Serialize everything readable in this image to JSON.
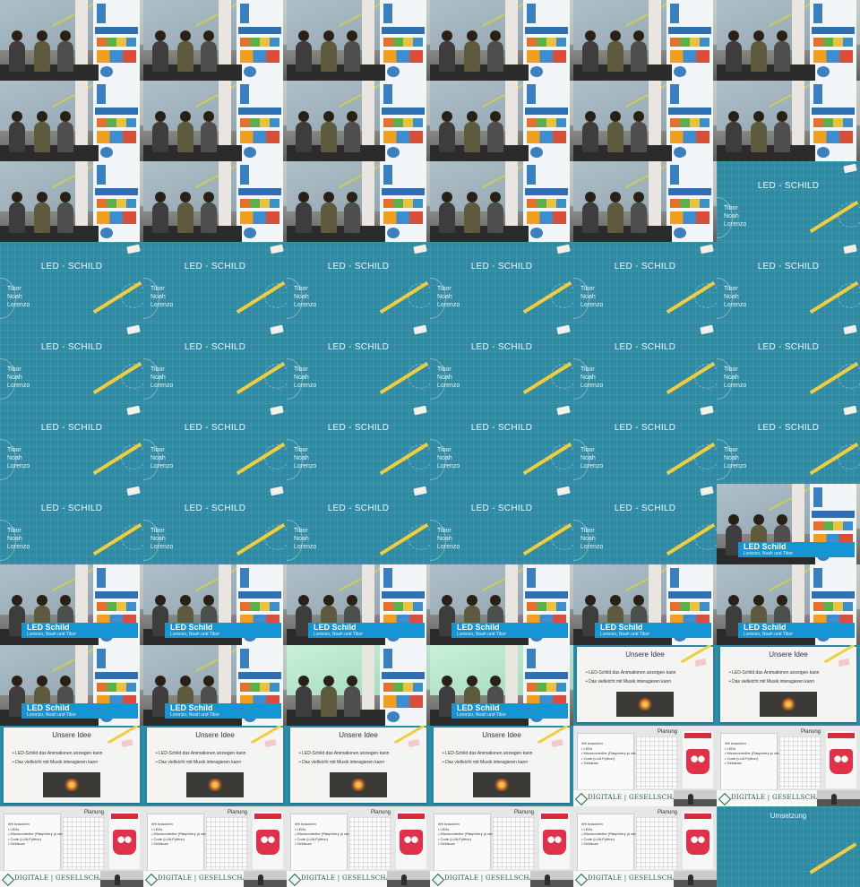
{
  "title_slide": {
    "title": "LED - SCHILD",
    "names": [
      "Tibor",
      "Noah",
      "Lorenzo"
    ]
  },
  "lower_third": {
    "title": "LED Schild",
    "subtitle": "Lorenzo, Noah und Tibor"
  },
  "idea_slide": {
    "title": "Unsere Idee",
    "bullets": [
      "LED-Schild das Animationen anzeigen kann",
      "Das vielleicht mit Musik interagieren kann"
    ]
  },
  "plan_slide": {
    "title": "Planung",
    "list_heading": "Wir brauchen",
    "list_items": [
      "LEDs",
      "Microcontroller (Raspberry pi zero)",
      "Code (LUA Python)",
      "Gehäuse"
    ],
    "footer_brand": "DIGITALE | GESELLSCHAFT"
  },
  "ums_slide": {
    "title": "Umsetzung"
  },
  "colors": {
    "slide_blue": "#2f8aa3",
    "lower_third_blue": "#1595d3",
    "pencil_yellow": "#f0cd3d",
    "pixel_red": "#e0304a"
  }
}
